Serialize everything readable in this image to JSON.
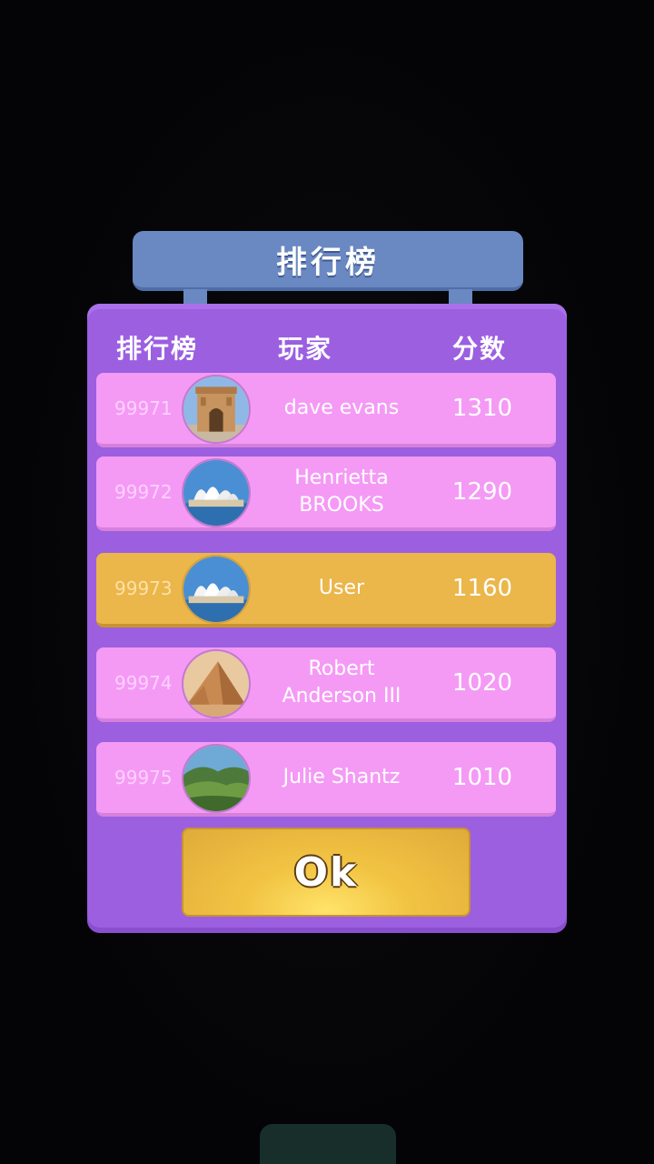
{
  "dialog": {
    "title": "排行榜"
  },
  "columns": {
    "rank": "排行榜",
    "player": "玩家",
    "score": "分数"
  },
  "rows": [
    {
      "rank": "99971",
      "name": "dave evans",
      "score": "1310",
      "avatar": "arc-de-triomphe-icon",
      "highlight": false
    },
    {
      "rank": "99972",
      "name": "Henrietta BROOKS",
      "score": "1290",
      "avatar": "sydney-opera-house-icon",
      "highlight": false
    },
    {
      "rank": "99973",
      "name": "User",
      "score": "1160",
      "avatar": "sydney-opera-house-icon",
      "highlight": true
    },
    {
      "rank": "99974",
      "name": "Robert Anderson III",
      "score": "1020",
      "avatar": "pyramid-icon",
      "highlight": false
    },
    {
      "rank": "99975",
      "name": "Julie Shantz",
      "score": "1010",
      "avatar": "green-hills-icon",
      "highlight": false
    }
  ],
  "ok_button": {
    "label": "Ok"
  },
  "colors": {
    "panel": "#9b5fe0",
    "row": "#f49af5",
    "row_highlight": "#ebb64a",
    "banner": "#6a88c2",
    "button": "#f2c443"
  }
}
